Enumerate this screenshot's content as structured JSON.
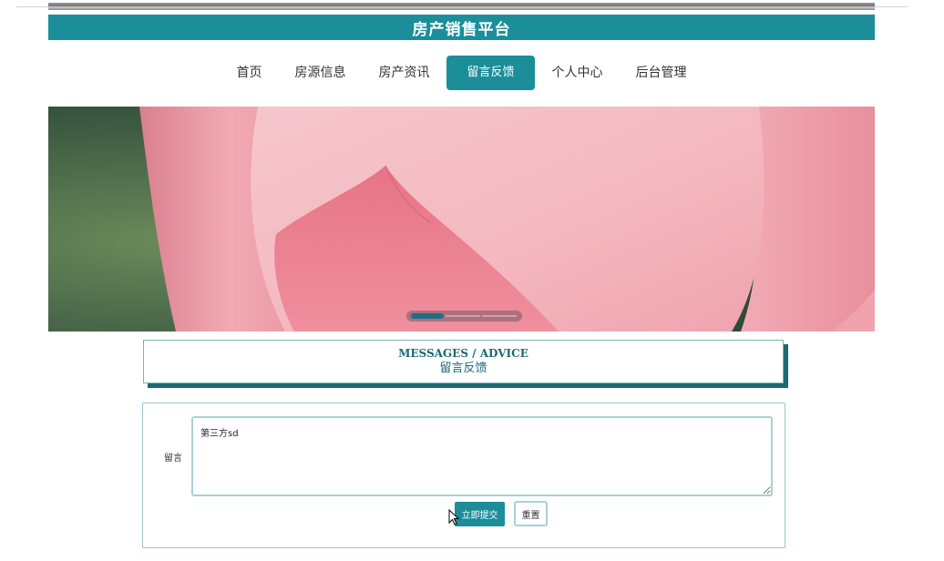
{
  "site": {
    "title": "房产销售平台"
  },
  "nav": {
    "items": [
      {
        "label": "首页",
        "active": false
      },
      {
        "label": "房源信息",
        "active": false
      },
      {
        "label": "房产资讯",
        "active": false
      },
      {
        "label": "留言反馈",
        "active": true
      },
      {
        "label": "个人中心",
        "active": false
      },
      {
        "label": "后台管理",
        "active": false
      }
    ]
  },
  "banner": {
    "image_icon": "lotus-photo",
    "slide_count": 3,
    "active_slide": 1
  },
  "section": {
    "title_en": "MESSAGES / ADVICE",
    "title_cn": "留言反馈"
  },
  "form": {
    "message_label": "留言",
    "message_value": "第三方sd",
    "submit_label": "立即提交",
    "reset_label": "重置"
  },
  "colors": {
    "accent": "#1b8e9a",
    "accent_dark": "#1a6a74"
  }
}
